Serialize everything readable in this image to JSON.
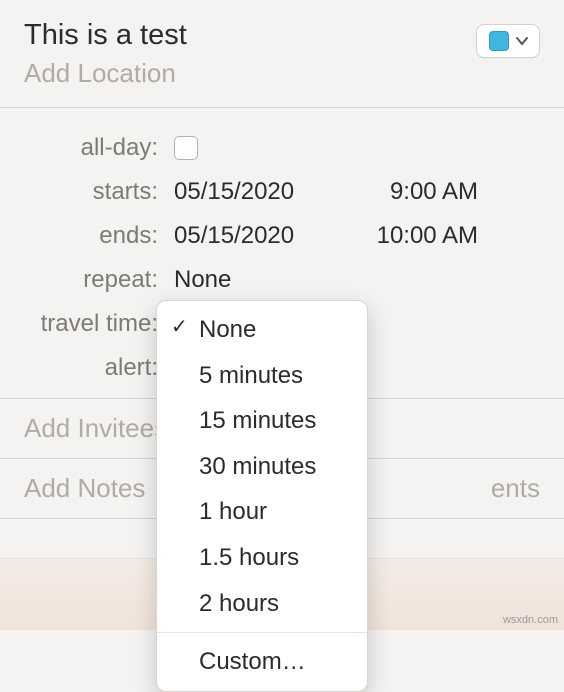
{
  "header": {
    "title": "This is a test",
    "location_placeholder": "Add Location",
    "calendar_color": "#3eb6e0"
  },
  "fields": {
    "all_day": {
      "label": "all-day:",
      "checked": false
    },
    "starts": {
      "label": "starts:",
      "date": "05/15/2020",
      "time": "9:00 AM"
    },
    "ends": {
      "label": "ends:",
      "date": "05/15/2020",
      "time": "10:00 AM"
    },
    "repeat": {
      "label": "repeat:",
      "value": "None"
    },
    "travel_time": {
      "label": "travel time:"
    },
    "alert": {
      "label": "alert:"
    }
  },
  "sections": {
    "invitees": "Add Invitees",
    "notes": "Add Notes",
    "attachments_suffix": "ents"
  },
  "dropdown": {
    "selected_index": 0,
    "items": [
      "None",
      "5 minutes",
      "15 minutes",
      "30 minutes",
      "1 hour",
      "1.5 hours",
      "2 hours"
    ],
    "custom": "Custom…"
  },
  "watermark": "wsxdn.com"
}
